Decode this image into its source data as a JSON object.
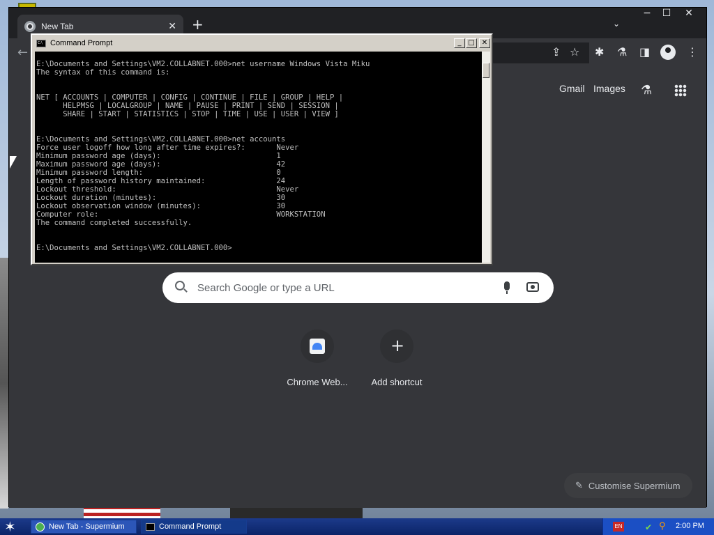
{
  "desktop": {},
  "chrome": {
    "tab": {
      "title": "New Tab",
      "close_glyph": "✕"
    },
    "new_tab_glyph": "+",
    "tab_search_glyph": "⌄",
    "window_controls": {
      "minimize": "−",
      "maximize": "☐",
      "close": "✕"
    },
    "toolbar": {
      "back_glyph": "←",
      "share_glyph": "⇪",
      "star_glyph": "☆",
      "extensions_glyph": "✱",
      "labs_glyph": "⚗",
      "sidepanel_glyph": "◨",
      "menu_glyph": "⋮"
    },
    "ntp": {
      "links": {
        "gmail": "Gmail",
        "images": "Images"
      },
      "labs_glyph": "⚗",
      "search": {
        "placeholder": "Search Google or type a URL"
      },
      "shortcuts": [
        {
          "label": "Chrome Web..."
        },
        {
          "label": "Add shortcut",
          "icon_glyph": "+"
        }
      ],
      "customise": {
        "label": "Customise Supermium",
        "icon_glyph": "✎"
      }
    }
  },
  "cmd": {
    "title": "Command Prompt",
    "buttons": {
      "minimize": "_",
      "maximize": "□",
      "close": "✕"
    },
    "output": "\nE:\\Documents and Settings\\VM2.COLLABNET.000>net username Windows Vista Miku\nThe syntax of this command is:\n\n\nNET [ ACCOUNTS | COMPUTER | CONFIG | CONTINUE | FILE | GROUP | HELP |\n      HELPMSG | LOCALGROUP | NAME | PAUSE | PRINT | SEND | SESSION |\n      SHARE | START | STATISTICS | STOP | TIME | USE | USER | VIEW ]\n\n\nE:\\Documents and Settings\\VM2.COLLABNET.000>net accounts\nForce user logoff how long after time expires?:       Never\nMinimum password age (days):                          1\nMaximum password age (days):                          42\nMinimum password length:                              0\nLength of password history maintained:                24\nLockout threshold:                                    Never\nLockout duration (minutes):                           30\nLockout observation window (minutes):                 30\nComputer role:                                        WORKSTATION\nThe command completed successfully.\n\n\nE:\\Documents and Settings\\VM2.COLLABNET.000>"
  },
  "taskbar": {
    "start_glyph": "✶",
    "items": [
      {
        "label": "New Tab - Supermium"
      },
      {
        "label": "Command Prompt"
      }
    ],
    "tray": {
      "language": "EN",
      "clock": "2:00 PM"
    }
  }
}
